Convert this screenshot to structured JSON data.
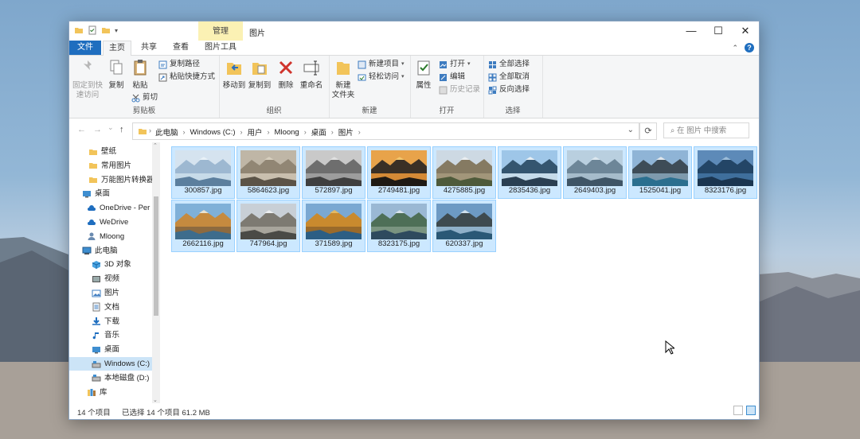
{
  "window": {
    "context_tab": "管理",
    "title": "图片",
    "caption": {
      "minimize": "—",
      "maximize": "☐",
      "close": "✕"
    }
  },
  "tabs": {
    "file": "文件",
    "home": "主页",
    "share": "共享",
    "view": "查看",
    "manage": "图片工具"
  },
  "ribbon": {
    "clipboard": {
      "pin": "固定到快\n速访问",
      "copy": "复制",
      "paste": "粘贴",
      "copy_path": "复制路径",
      "paste_shortcut": "粘贴快捷方式",
      "cut": "剪切",
      "label": "剪贴板"
    },
    "organize": {
      "move_to": "移动到",
      "copy_to": "复制到",
      "delete": "删除",
      "rename": "重命名",
      "label": "组织"
    },
    "new": {
      "new_folder": "新建\n文件夹",
      "new_item": "新建项目",
      "easy_access": "轻松访问",
      "label": "新建"
    },
    "open": {
      "properties": "属性",
      "open": "打开",
      "edit": "编辑",
      "history": "历史记录",
      "label": "打开"
    },
    "select": {
      "select_all": "全部选择",
      "select_none": "全部取消",
      "invert": "反向选择",
      "label": "选择"
    }
  },
  "address": {
    "nav": {
      "back": "←",
      "forward": "→",
      "recent": "⌄",
      "up": "↑"
    },
    "crumbs": [
      "此电脑",
      "Windows (C:)",
      "用户",
      "Mloong",
      "桌面",
      "图片"
    ],
    "search_placeholder": "在 图片 中搜索"
  },
  "navpane": {
    "items": [
      {
        "label": "壁纸",
        "icon": "folder-icon"
      },
      {
        "label": "常用图片",
        "icon": "folder-icon"
      },
      {
        "label": "万能图片转换器",
        "icon": "folder-icon"
      },
      {
        "label": "桌面",
        "icon": "desktop-icon"
      },
      {
        "label": "OneDrive - Per",
        "icon": "cloud-icon"
      },
      {
        "label": "WeDrive",
        "icon": "cloud-icon"
      },
      {
        "label": "Mloong",
        "icon": "user-icon"
      },
      {
        "label": "此电脑",
        "icon": "pc-icon"
      },
      {
        "label": "3D 对象",
        "icon": "cube-icon"
      },
      {
        "label": "视频",
        "icon": "video-icon"
      },
      {
        "label": "图片",
        "icon": "picture-icon"
      },
      {
        "label": "文档",
        "icon": "document-icon"
      },
      {
        "label": "下载",
        "icon": "download-icon"
      },
      {
        "label": "音乐",
        "icon": "music-icon"
      },
      {
        "label": "桌面",
        "icon": "desktop-icon"
      },
      {
        "label": "Windows (C:)",
        "icon": "drive-icon"
      },
      {
        "label": "本地磁盘 (D:)",
        "icon": "drive-icon"
      },
      {
        "label": "库",
        "icon": "library-icon"
      }
    ],
    "selected": "Windows (C:)"
  },
  "files": [
    {
      "name": "300857.jpg",
      "scene": "lake"
    },
    {
      "name": "5864623.jpg",
      "scene": "misty"
    },
    {
      "name": "572897.jpg",
      "scene": "storm"
    },
    {
      "name": "2749481.jpg",
      "scene": "sunset"
    },
    {
      "name": "4275885.jpg",
      "scene": "meadow"
    },
    {
      "name": "2835436.jpg",
      "scene": "snow"
    },
    {
      "name": "2649403.jpg",
      "scene": "calm"
    },
    {
      "name": "1525041.jpg",
      "scene": "peaks"
    },
    {
      "name": "8323176.jpg",
      "scene": "blue"
    },
    {
      "name": "2662116.jpg",
      "scene": "valley"
    },
    {
      "name": "747964.jpg",
      "scene": "canyon"
    },
    {
      "name": "371589.jpg",
      "scene": "autumn"
    },
    {
      "name": "8323175.jpg",
      "scene": "hills"
    },
    {
      "name": "620337.jpg",
      "scene": "reflection"
    }
  ],
  "status": {
    "count": "14 个项目",
    "selected": "已选择 14 个项目 61.2 MB"
  }
}
